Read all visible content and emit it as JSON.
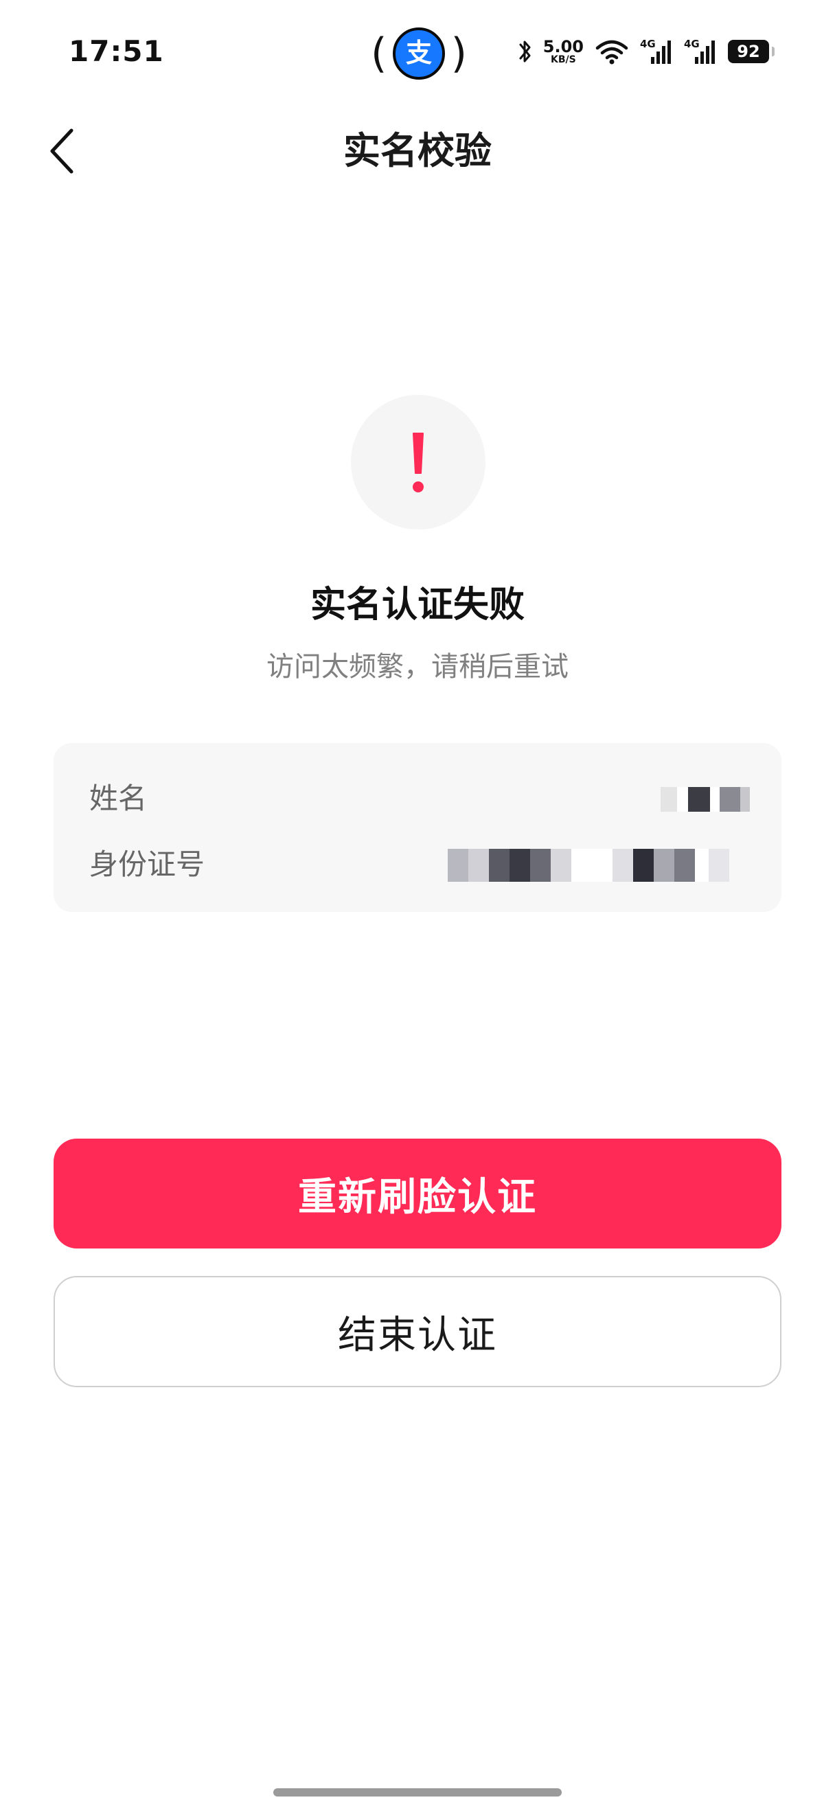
{
  "status_bar": {
    "time": "17:51",
    "app_indicator": "支",
    "net_speed_value": "5.00",
    "net_speed_unit": "KB/S",
    "network_type_1": "4G",
    "network_type_2": "4G",
    "battery": "92",
    "icons": [
      "bluetooth-icon",
      "wifi-icon",
      "signal-icon",
      "signal-icon",
      "battery-icon"
    ]
  },
  "nav": {
    "title": "实名校验",
    "back_icon": "chevron-left-icon"
  },
  "result": {
    "icon": "exclamation-icon",
    "icon_color": "#ff2a55",
    "title": "实名认证失败",
    "message": "访问太频繁，请稍后重试"
  },
  "info": {
    "name_label": "姓名",
    "id_label": "身份证号"
  },
  "actions": {
    "primary_label": "重新刷脸认证",
    "secondary_label": "结束认证",
    "accent_color": "#ff2a55"
  }
}
